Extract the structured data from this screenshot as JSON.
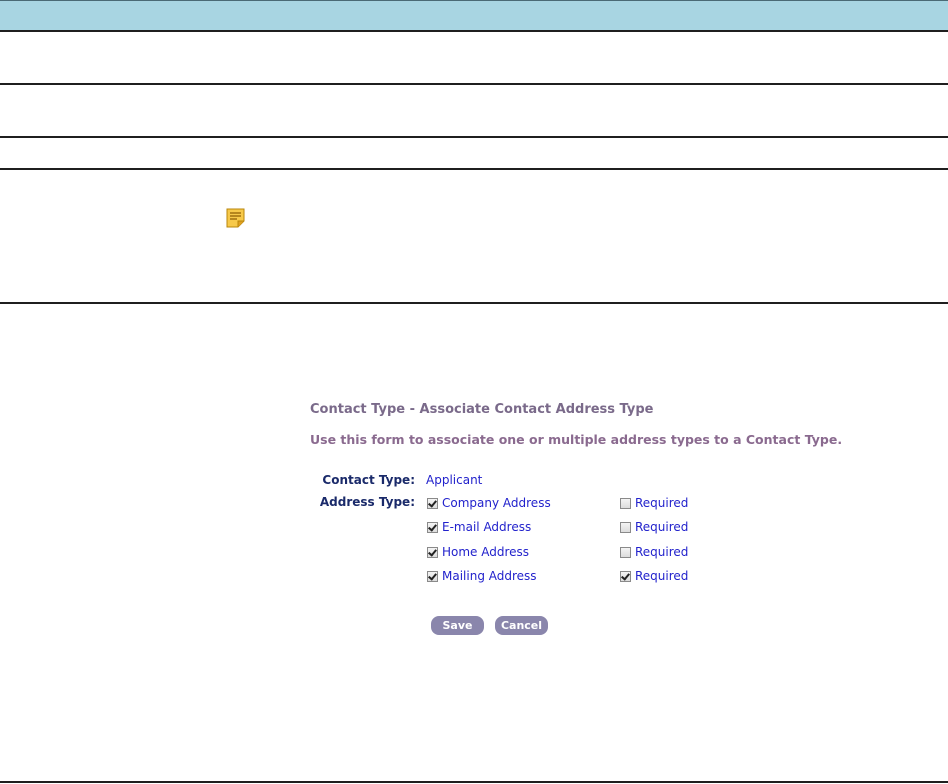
{
  "form": {
    "title": "Contact Type - Associate Contact Address Type",
    "instructions": "Use this form to associate one or multiple address types to a Contact Type.",
    "contact_type_label": "Contact Type:",
    "contact_type_value": "Applicant",
    "address_type_label": "Address Type:",
    "address_types": [
      {
        "label": "Company Address",
        "selected": true,
        "required_label": "Required",
        "required": false
      },
      {
        "label": "E-mail Address",
        "selected": true,
        "required_label": "Required",
        "required": false
      },
      {
        "label": "Home Address",
        "selected": true,
        "required_label": "Required",
        "required": false
      },
      {
        "label": "Mailing Address",
        "selected": true,
        "required_label": "Required",
        "required": true
      }
    ],
    "save_label": "Save",
    "cancel_label": "Cancel"
  },
  "icons": {
    "note": "note-icon"
  },
  "colors": {
    "header_bar": "#a8d5e2",
    "title": "#7a6a8a",
    "label": "#1a2a6a",
    "value": "#2222cc",
    "button": "#8a86ac"
  }
}
